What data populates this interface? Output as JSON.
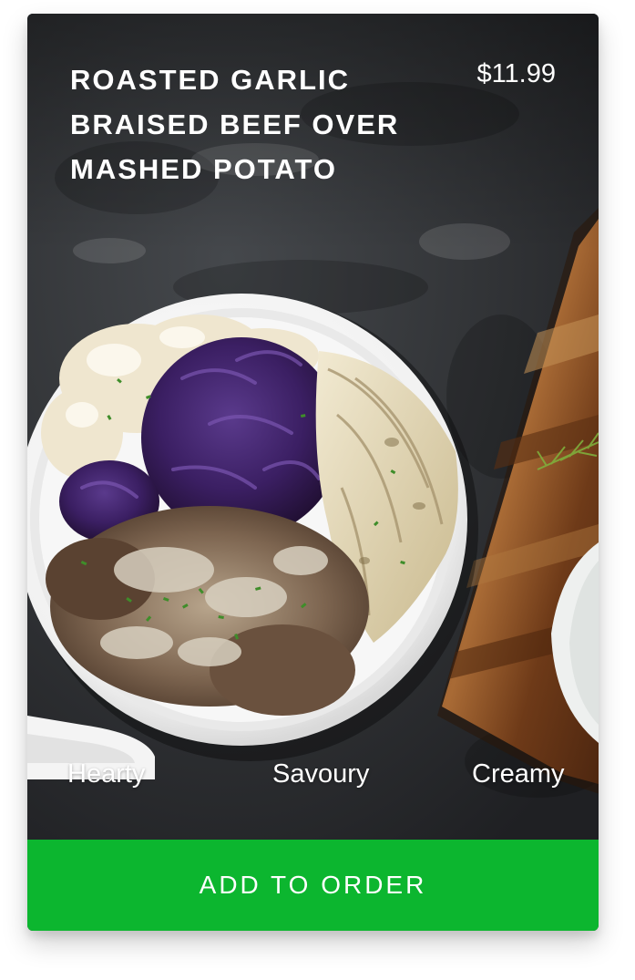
{
  "product": {
    "title": "ROASTED GARLIC\nBRAISED BEEF OVER\nMASHED POTATO",
    "price": "$11.99",
    "tags": [
      "Hearty",
      "Savoury",
      "Creamy"
    ],
    "image_icon": "food-photo"
  },
  "actions": {
    "add_to_order_label": "ADD TO ORDER"
  },
  "colors": {
    "background_slate": "#2b2d30",
    "cta_green": "#0cb62f",
    "text": "#ffffff"
  }
}
